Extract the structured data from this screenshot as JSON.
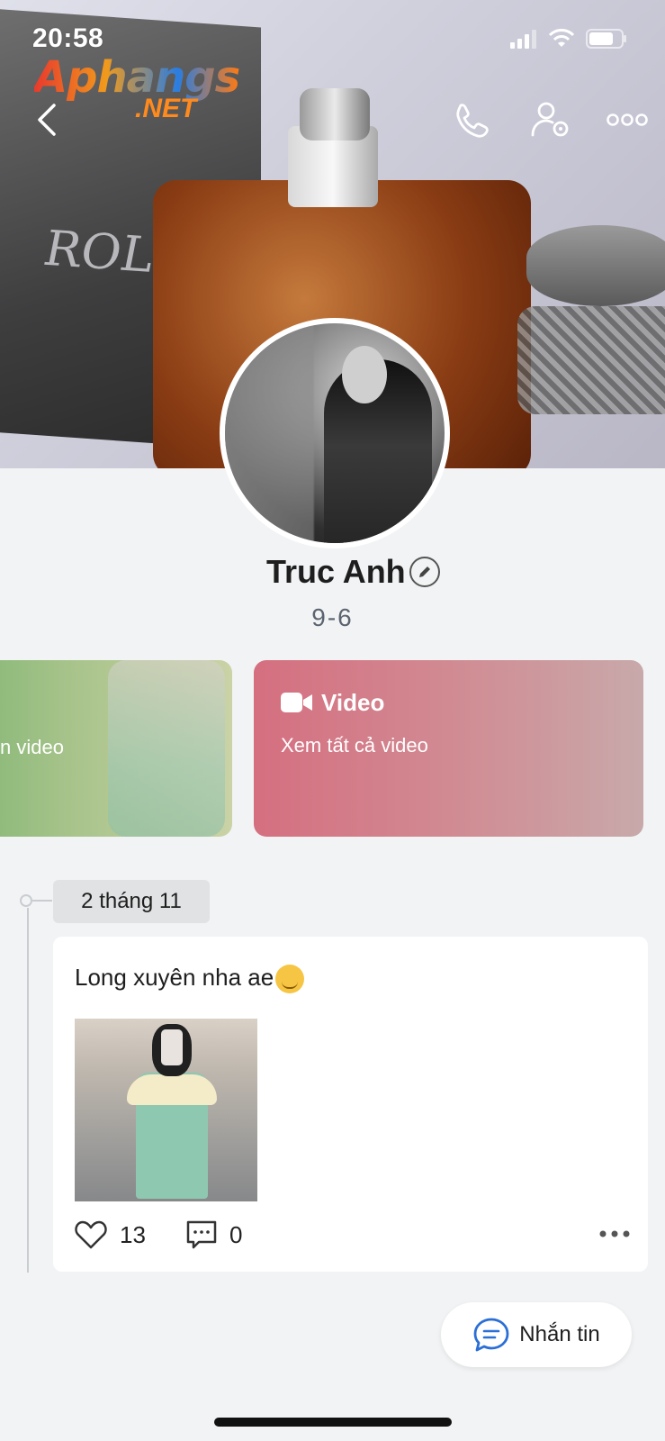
{
  "status_bar": {
    "time": "20:58"
  },
  "watermark": {
    "brand": "Aphangs",
    "suffix": ".NET"
  },
  "profile": {
    "name": "Truc Anh",
    "subtitle": "9-6"
  },
  "cards": {
    "photo_card_label": "n video",
    "video_card_title": "Video",
    "video_card_subtitle": "Xem tất cả video"
  },
  "timeline": {
    "date": "2 tháng 11",
    "post": {
      "text": "Long xuyên nha ae",
      "likes": "13",
      "comments": "0"
    }
  },
  "message_button": {
    "label": "Nhắn tin"
  },
  "colors": {
    "accent": "#2b6fd6",
    "video_card": "#d56f80",
    "photo_card": "#88b878",
    "background": "#f2f3f4"
  },
  "icons": [
    "back-icon",
    "phone-icon",
    "user-settings-icon",
    "more-icon",
    "edit-icon",
    "video-icon",
    "heart-icon",
    "comment-icon",
    "chat-icon"
  ]
}
